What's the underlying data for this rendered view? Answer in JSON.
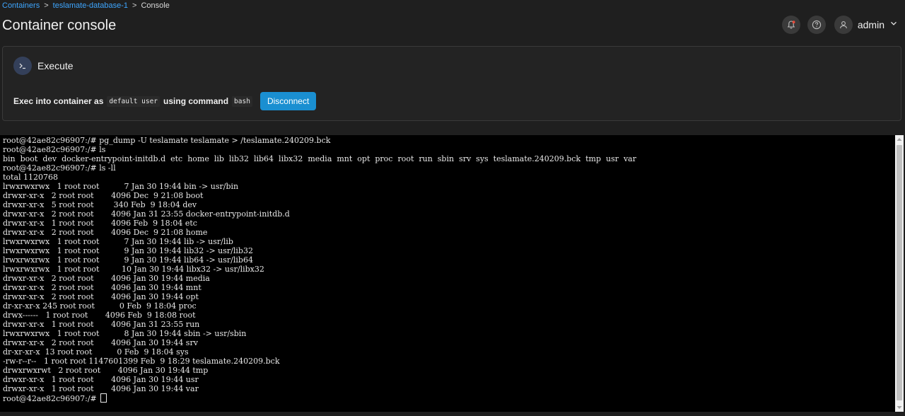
{
  "breadcrumb": {
    "items": [
      "Containers",
      "teslamate-database-1",
      "Console"
    ],
    "separator": ">"
  },
  "page_title": "Container console",
  "user": {
    "name": "admin"
  },
  "exec": {
    "title": "Execute",
    "prefix": "Exec into container as",
    "user_code": "default user",
    "middle": "using command",
    "command_code": "bash",
    "disconnect_label": "Disconnect"
  },
  "colors": {
    "accent": "#1a8fd1",
    "link": "#3ea6ff",
    "terminal_bg": "#000000",
    "notification_dot": "#e74c3c"
  },
  "icons": {
    "notifications": "bell-icon",
    "help": "help-icon",
    "user": "user-icon",
    "dropdown": "chevron-down-icon",
    "execute": "terminal-icon"
  },
  "terminal": {
    "lines": [
      "root@42ae82c96907:/# pg_dump -U teslamate teslamate > /teslamate.240209.bck",
      "root@42ae82c96907:/# ls",
      "bin  boot  dev  docker-entrypoint-initdb.d  etc  home  lib  lib32  lib64  libx32  media  mnt  opt  proc  root  run  sbin  srv  sys  teslamate.240209.bck  tmp  usr  var",
      "root@42ae82c96907:/# ls -ll",
      "total 1120768",
      "lrwxrwxrwx   1 root root          7 Jan 30 19:44 bin -> usr/bin",
      "drwxr-xr-x   2 root root       4096 Dec  9 21:08 boot",
      "drwxr-xr-x   5 root root        340 Feb  9 18:04 dev",
      "drwxr-xr-x   2 root root       4096 Jan 31 23:55 docker-entrypoint-initdb.d",
      "drwxr-xr-x   1 root root       4096 Feb  9 18:04 etc",
      "drwxr-xr-x   2 root root       4096 Dec  9 21:08 home",
      "lrwxrwxrwx   1 root root          7 Jan 30 19:44 lib -> usr/lib",
      "lrwxrwxrwx   1 root root          9 Jan 30 19:44 lib32 -> usr/lib32",
      "lrwxrwxrwx   1 root root          9 Jan 30 19:44 lib64 -> usr/lib64",
      "lrwxrwxrwx   1 root root         10 Jan 30 19:44 libx32 -> usr/libx32",
      "drwxr-xr-x   2 root root       4096 Jan 30 19:44 media",
      "drwxr-xr-x   2 root root       4096 Jan 30 19:44 mnt",
      "drwxr-xr-x   2 root root       4096 Jan 30 19:44 opt",
      "dr-xr-xr-x 245 root root          0 Feb  9 18:04 proc",
      "drwx------   1 root root       4096 Feb  9 18:08 root",
      "drwxr-xr-x   1 root root       4096 Jan 31 23:55 run",
      "lrwxrwxrwx   1 root root          8 Jan 30 19:44 sbin -> usr/sbin",
      "drwxr-xr-x   2 root root       4096 Jan 30 19:44 srv",
      "dr-xr-xr-x  13 root root          0 Feb  9 18:04 sys",
      "-rw-r--r--   1 root root 1147601399 Feb  9 18:29 teslamate.240209.bck",
      "drwxrwxrwt   2 root root       4096 Jan 30 19:44 tmp",
      "drwxr-xr-x   1 root root       4096 Jan 30 19:44 usr",
      "drwxr-xr-x   1 root root       4096 Jan 30 19:44 var"
    ],
    "prompt": "root@42ae82c96907:/# "
  }
}
